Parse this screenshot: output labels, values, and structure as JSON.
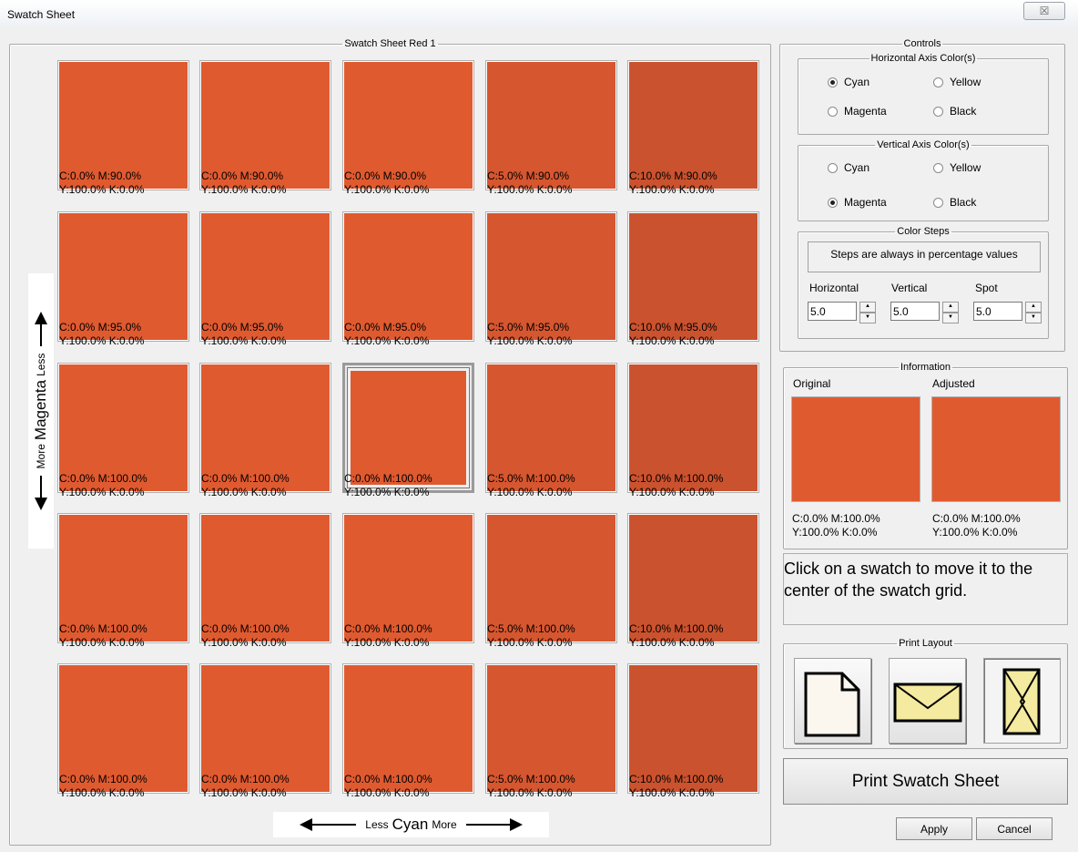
{
  "window": {
    "title": "Swatch Sheet",
    "close_glyph": "☒"
  },
  "sheet": {
    "legend": "Swatch Sheet Red 1",
    "swatches": [
      {
        "color": "#e05a30",
        "line1": "C:0.0% M:90.0%",
        "line2": "Y:100.0% K:0.0%"
      },
      {
        "color": "#e05a30",
        "line1": "C:0.0% M:90.0%",
        "line2": "Y:100.0% K:0.0%"
      },
      {
        "color": "#e05a30",
        "line1": "C:0.0% M:90.0%",
        "line2": "Y:100.0% K:0.0%"
      },
      {
        "color": "#d6562f",
        "line1": "C:5.0% M:90.0%",
        "line2": "Y:100.0% K:0.0%"
      },
      {
        "color": "#cb522e",
        "line1": "C:10.0% M:90.0%",
        "line2": "Y:100.0% K:0.0%"
      },
      {
        "color": "#e05a30",
        "line1": "C:0.0% M:95.0%",
        "line2": "Y:100.0% K:0.0%"
      },
      {
        "color": "#e05a30",
        "line1": "C:0.0% M:95.0%",
        "line2": "Y:100.0% K:0.0%"
      },
      {
        "color": "#e05a30",
        "line1": "C:0.0% M:95.0%",
        "line2": "Y:100.0% K:0.0%"
      },
      {
        "color": "#d6562f",
        "line1": "C:5.0% M:95.0%",
        "line2": "Y:100.0% K:0.0%"
      },
      {
        "color": "#cb522e",
        "line1": "C:10.0% M:95.0%",
        "line2": "Y:100.0% K:0.0%"
      },
      {
        "color": "#e05a30",
        "line1": "C:0.0% M:100.0%",
        "line2": "Y:100.0% K:0.0%"
      },
      {
        "color": "#e05a30",
        "line1": "C:0.0% M:100.0%",
        "line2": "Y:100.0% K:0.0%"
      },
      {
        "color": "#e05a30",
        "line1": "C:0.0% M:100.0%",
        "line2": "Y:100.0% K:0.0%",
        "selected": true
      },
      {
        "color": "#d6562f",
        "line1": "C:5.0% M:100.0%",
        "line2": "Y:100.0% K:0.0%"
      },
      {
        "color": "#cb522e",
        "line1": "C:10.0% M:100.0%",
        "line2": "Y:100.0% K:0.0%"
      },
      {
        "color": "#e05a30",
        "line1": "C:0.0% M:100.0%",
        "line2": "Y:100.0% K:0.0%"
      },
      {
        "color": "#e05a30",
        "line1": "C:0.0% M:100.0%",
        "line2": "Y:100.0% K:0.0%"
      },
      {
        "color": "#e05a30",
        "line1": "C:0.0% M:100.0%",
        "line2": "Y:100.0% K:0.0%"
      },
      {
        "color": "#d6562f",
        "line1": "C:5.0% M:100.0%",
        "line2": "Y:100.0% K:0.0%"
      },
      {
        "color": "#cb522e",
        "line1": "C:10.0% M:100.0%",
        "line2": "Y:100.0% K:0.0%"
      },
      {
        "color": "#e05a30",
        "line1": "C:0.0% M:100.0%",
        "line2": "Y:100.0% K:0.0%"
      },
      {
        "color": "#e05a30",
        "line1": "C:0.0% M:100.0%",
        "line2": "Y:100.0% K:0.0%"
      },
      {
        "color": "#e05a30",
        "line1": "C:0.0% M:100.0%",
        "line2": "Y:100.0% K:0.0%"
      },
      {
        "color": "#d6562f",
        "line1": "C:5.0% M:100.0%",
        "line2": "Y:100.0% K:0.0%"
      },
      {
        "color": "#cb522e",
        "line1": "C:10.0% M:100.0%",
        "line2": "Y:100.0% K:0.0%"
      }
    ],
    "vertical_axis": {
      "more": "More",
      "ink": "Magenta",
      "less": "Less"
    },
    "horizontal_axis": {
      "less": "Less",
      "ink": "Cyan",
      "more": "More"
    }
  },
  "controls": {
    "legend": "Controls",
    "horizontal_axis": {
      "legend": "Horizontal Axis Color(s)",
      "options": [
        {
          "label": "Cyan",
          "checked": true
        },
        {
          "label": "Yellow",
          "checked": false
        },
        {
          "label": "Magenta",
          "checked": false
        },
        {
          "label": "Black",
          "checked": false
        }
      ]
    },
    "vertical_axis": {
      "legend": "Vertical Axis Color(s)",
      "options": [
        {
          "label": "Cyan",
          "checked": false
        },
        {
          "label": "Yellow",
          "checked": false
        },
        {
          "label": "Magenta",
          "checked": true
        },
        {
          "label": "Black",
          "checked": false
        }
      ]
    },
    "color_steps": {
      "legend": "Color Steps",
      "note": "Steps are always in percentage values",
      "horizontal_label": "Horizontal",
      "horizontal_value": "5.0",
      "vertical_label": "Vertical",
      "vertical_value": "5.0",
      "spot_label": "Spot",
      "spot_value": "5.0"
    }
  },
  "information": {
    "legend": "Information",
    "original": {
      "label": "Original",
      "color": "#e05a30",
      "line1": "C:0.0% M:100.0%",
      "line2": "Y:100.0% K:0.0%"
    },
    "adjusted": {
      "label": "Adjusted",
      "color": "#e05a30",
      "line1": "C:0.0% M:100.0%",
      "line2": "Y:100.0% K:0.0%"
    }
  },
  "message": "Click on a swatch to move it to the center of the swatch grid.",
  "print_layout": {
    "legend": "Print Layout",
    "options": [
      {
        "icon": "page-portrait-icon",
        "active": false
      },
      {
        "icon": "envelope-landscape-icon",
        "active": false
      },
      {
        "icon": "envelope-portrait-icon",
        "active": true
      }
    ]
  },
  "buttons": {
    "print": "Print Swatch Sheet",
    "apply": "Apply",
    "cancel": "Cancel"
  }
}
